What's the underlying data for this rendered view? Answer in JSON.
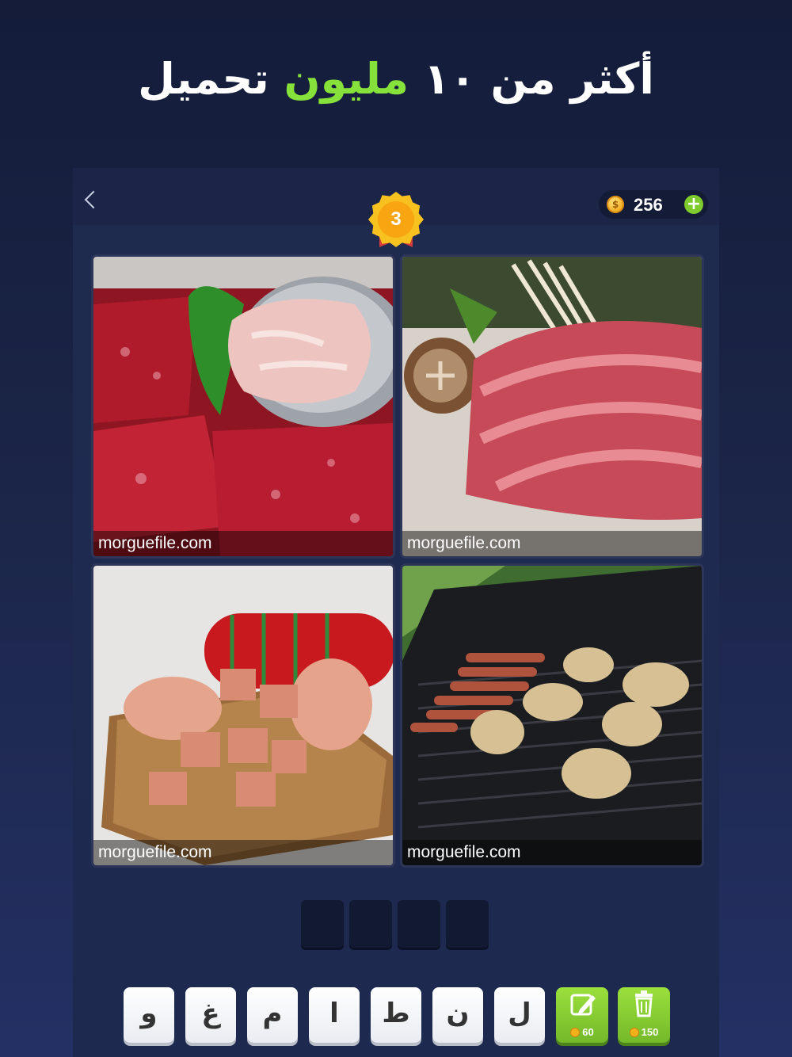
{
  "headline": {
    "part1": "أكثر من ١٠ ",
    "highlight": "مليون",
    "part2": " تحميل"
  },
  "topbar": {
    "coins": "256",
    "coin_symbol": "$",
    "plus_label": "+",
    "level": "3"
  },
  "tiles": [
    {
      "caption": "morguefile.com",
      "subject": "raw meat cuts in tray"
    },
    {
      "caption": "morguefile.com",
      "subject": "sliced beef with mushrooms"
    },
    {
      "caption": "morguefile.com",
      "subject": "mortadella sausage on board"
    },
    {
      "caption": "morguefile.com",
      "subject": "grill with sausages and chicken"
    }
  ],
  "answer_slots": 4,
  "keys": [
    "و",
    "غ",
    "م",
    "ا",
    "ط",
    "ن",
    "ل"
  ],
  "powerups": {
    "reveal": {
      "cost": "60",
      "icon": "pencil-icon"
    },
    "remove": {
      "cost": "150",
      "icon": "trash-icon"
    }
  },
  "colors": {
    "highlight_green": "#86e23a",
    "power_green": "#8ad437",
    "coin_gold": "#f7c21f"
  }
}
